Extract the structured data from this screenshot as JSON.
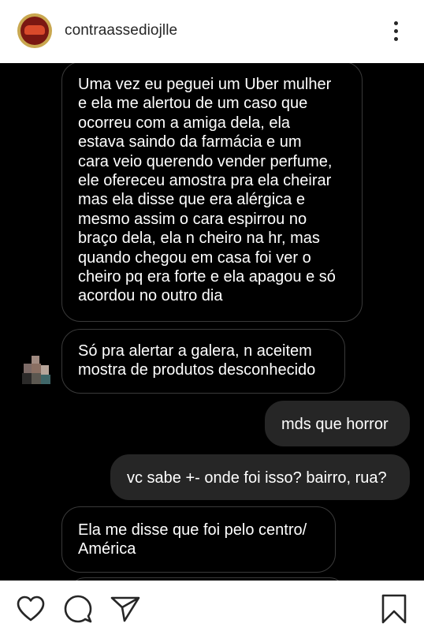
{
  "header": {
    "username": "contraassediojlle",
    "avatar": "profile-avatar-logo",
    "more_icon": "more-vertical-icon"
  },
  "messages": [
    {
      "direction": "received",
      "lines": [
        "Uma vez eu peguei um Uber mulher",
        "e ela me alertou de um caso que",
        "ocorreu com a amiga dela, ela",
        "estava saindo da farmácia e um",
        "cara veio querendo vender perfume,",
        "ele ofereceu amostra pra ela cheirar",
        "mas ela disse que era alérgica e",
        "mesmo assim o cara espirrou no",
        "braço dela, ela n cheiro na hr, mas",
        "quando chegou em casa foi ver o",
        "cheiro pq era forte e ela apagou e só",
        "acordou no outro dia"
      ]
    },
    {
      "direction": "received",
      "lines": [
        "Só pra alertar a galera, n aceitem",
        "mostra de produtos desconhecido"
      ]
    },
    {
      "direction": "sent",
      "lines": [
        "mds que horror"
      ]
    },
    {
      "direction": "sent",
      "lines": [
        "vc sabe +- onde foi isso? bairro, rua?"
      ]
    },
    {
      "direction": "received",
      "lines": [
        "Ela me disse que foi pelo centro/",
        "América"
      ]
    }
  ],
  "footer": {
    "icons": [
      "heart-icon",
      "comment-icon",
      "share-icon",
      "bookmark-icon"
    ]
  },
  "colors": {
    "chat_background": "#000000",
    "received_border": "#3a3a3a",
    "sent_bubble": "#262626",
    "text": "#ffffff"
  }
}
